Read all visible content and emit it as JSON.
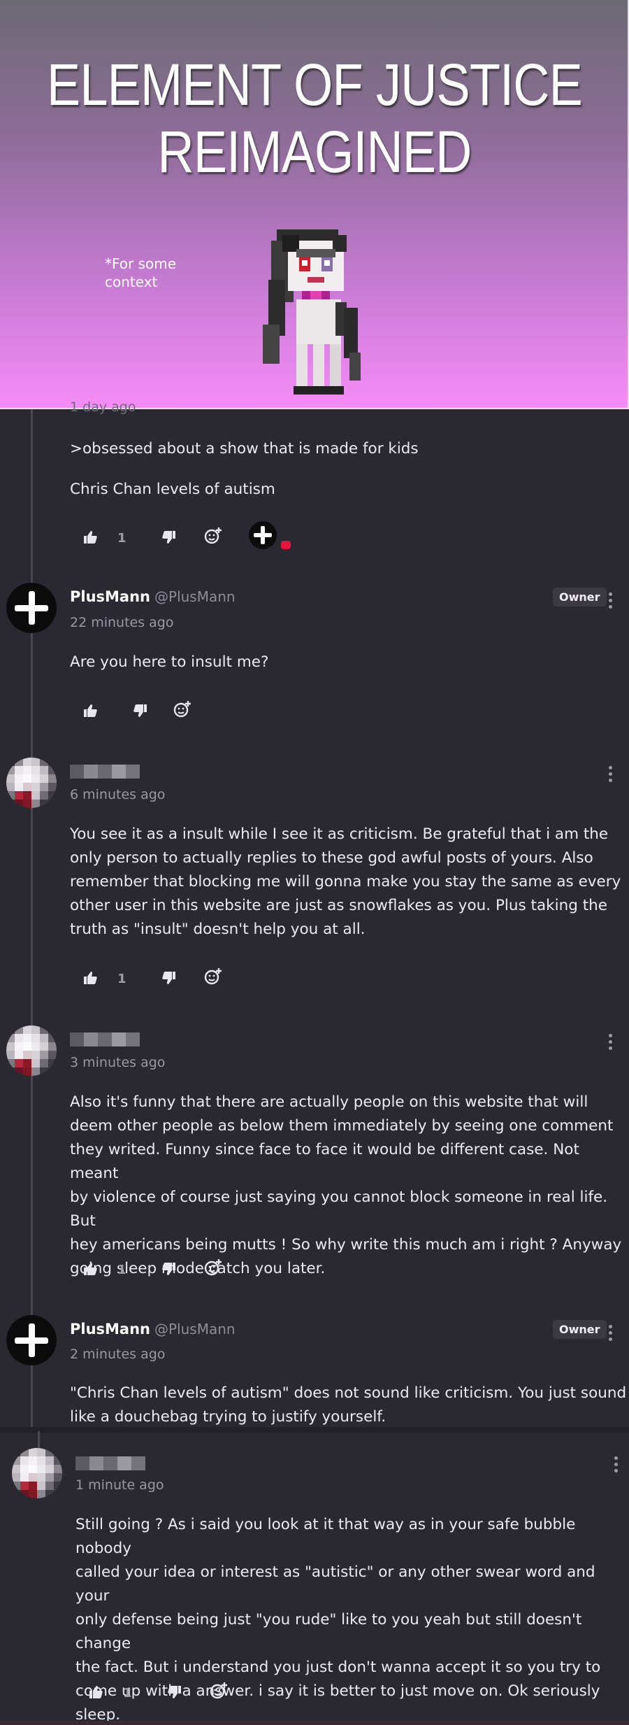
{
  "banner": {
    "title_line1": "ELEMENT OF JUSTICE",
    "title_line2": "REIMAGINED",
    "caption": "*For some context"
  },
  "comments": [
    {
      "timestamp": "1 day ago",
      "paragraphs": [
        ">obsessed about a show that is made for kids",
        "Chris Chan levels of autism"
      ],
      "likes": "1"
    },
    {
      "username": "PlusMann",
      "handle": "@PlusMann",
      "badge": "Owner",
      "timestamp": "22 minutes ago",
      "paragraphs": [
        "Are you here to insult me?"
      ]
    },
    {
      "timestamp": "6 minutes ago",
      "lines": [
        "You see it as a insult while I see it as criticism. Be grateful that i am the",
        "only person to actually replies to these god awful posts of yours. Also",
        "remember that blocking me will gonna make you stay the same as every",
        "other user in this website are just as snowflakes as you. Plus taking the",
        "truth as \"insult\" doesn't help you at all."
      ],
      "likes": "1"
    },
    {
      "timestamp": "3 minutes ago",
      "lines": [
        "Also it's funny that there are actually people on this website that will",
        "deem other people as below them immediately by seeing one comment",
        "they writed. Funny since face to face it would be different case. Not meant",
        "by violence of course just saying you cannot block someone in real life. But",
        "hey americans being mutts ! So why write this much am i right ? Anyway",
        "going sleep mode catch you later."
      ],
      "likes": "1"
    },
    {
      "username": "PlusMann",
      "handle": "@PlusMann",
      "badge": "Owner",
      "timestamp": "2 minutes ago",
      "lines": [
        "\"Chris Chan levels of autism\" does not sound like criticism. You just sound",
        "like a douchebag trying to justify yourself."
      ]
    },
    {
      "timestamp": "1 minute ago",
      "lines": [
        "Still going ? As i said you look at it that way as in your safe bubble nobody",
        "called your idea or interest as \"autistic\" or any other swear word and your",
        "only defense being just \"you rude\" like to you yeah but still doesn't change",
        "the fact. But i understand you just don't wanna accept it so you try to",
        "come up with a answer. i say it is better to just move on. Ok seriously",
        "sleep."
      ],
      "likes": "1"
    }
  ],
  "colors": {
    "background": "#2a2931",
    "accent_red": "#e8143c",
    "text": "#ecebf1",
    "muted": "#9a98a2"
  }
}
